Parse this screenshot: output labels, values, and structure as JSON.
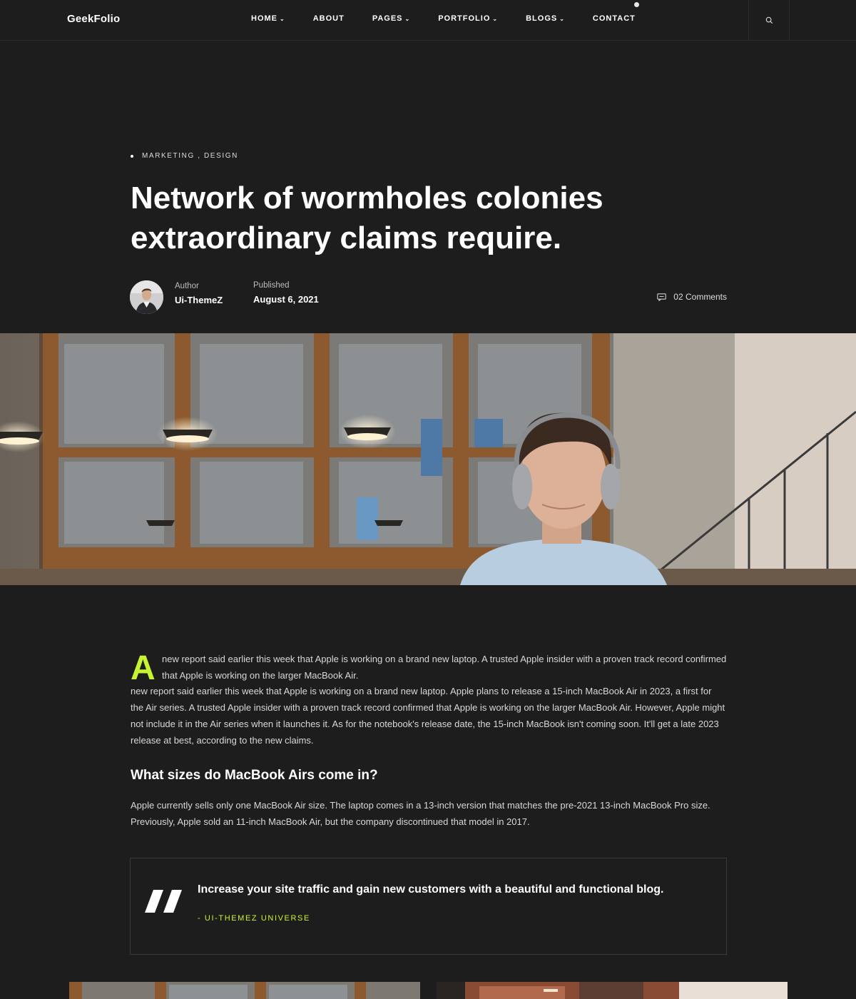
{
  "header": {
    "logo": "GeekFolio",
    "nav": [
      {
        "label": "HOME",
        "dropdown": true
      },
      {
        "label": "ABOUT",
        "dropdown": false
      },
      {
        "label": "PAGES",
        "dropdown": true
      },
      {
        "label": "PORTFOLIO",
        "dropdown": true
      },
      {
        "label": "BLOGS",
        "dropdown": true
      },
      {
        "label": "CONTACT",
        "dropdown": false
      }
    ],
    "caret": "⌄",
    "search_icon": "search-icon"
  },
  "post": {
    "categories": "MARKETING , DESIGN",
    "title": "Network of wormholes colonies extraordinary claims require.",
    "author_label": "Author",
    "author_name": "Ui-ThemeZ",
    "published_label": "Published",
    "published_date": "August 6, 2021",
    "comments": "02 Comments"
  },
  "article": {
    "dropcap": "A",
    "lead": "new report said earlier this week that Apple is working on a brand new laptop. A trusted Apple insider with a proven track record confirmed that Apple is working on the larger MacBook Air.",
    "paragraph1": "new report said earlier this week that Apple is working on a brand new laptop. Apple plans to release a 15-inch MacBook Air in 2023, a first for the Air series. A trusted Apple insider with a proven track record confirmed that Apple is working on the larger MacBook Air. However, Apple might not include it in the Air series when it launches it. As for the notebook's release date, the 15-inch MacBook isn't coming soon. It'll get a late 2023 release at best, according to the new claims.",
    "heading": "What sizes do MacBook Airs come in?",
    "paragraph2": "Apple currently sells only one MacBook Air size. The laptop comes in a 13-inch version that matches the pre-2021 13-inch MacBook Pro size. Previously, Apple sold an 11-inch MacBook Air, but the company discontinued that model in 2017."
  },
  "quote": {
    "text": "Increase your site traffic and gain new customers with a beautiful and functional blog.",
    "author": "- UI-THEMEZ UNIVERSE"
  },
  "colors": {
    "background": "#1d1d1d",
    "accent": "#c6f432",
    "text": "#ffffff"
  }
}
